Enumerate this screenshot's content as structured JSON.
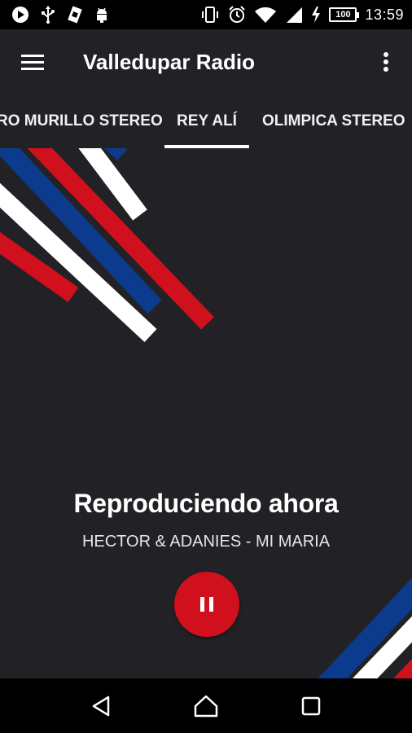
{
  "status_bar": {
    "battery_level": "100",
    "time": "13:59",
    "icons": [
      "play-notification-icon",
      "usb-icon",
      "sim-card-icon",
      "android-debug-icon",
      "vibrate-icon",
      "alarm-icon",
      "wifi-icon",
      "signal-icon",
      "charging-icon",
      "battery-icon"
    ]
  },
  "app_bar": {
    "title": "Valledupar Radio",
    "menu_icon": "hamburger-menu-icon",
    "overflow_icon": "more-vertical-icon"
  },
  "tabs": [
    {
      "label": "RO MURILLO STEREO",
      "selected": false
    },
    {
      "label": "REY ALÍ",
      "selected": true
    },
    {
      "label": "OLIMPICA STEREO",
      "selected": false
    }
  ],
  "player": {
    "heading": "Reproduciendo ahora",
    "track": "HECTOR & ADANIES - MI MARIA",
    "control_icon": "pause-icon"
  },
  "nav_bar": {
    "icons": [
      "back-icon",
      "home-icon",
      "recents-icon"
    ]
  },
  "colors": {
    "background": "#222226",
    "accent_red": "#d0101c",
    "stripe_blue": "#0c3a8c",
    "stripe_white": "#ffffff"
  }
}
